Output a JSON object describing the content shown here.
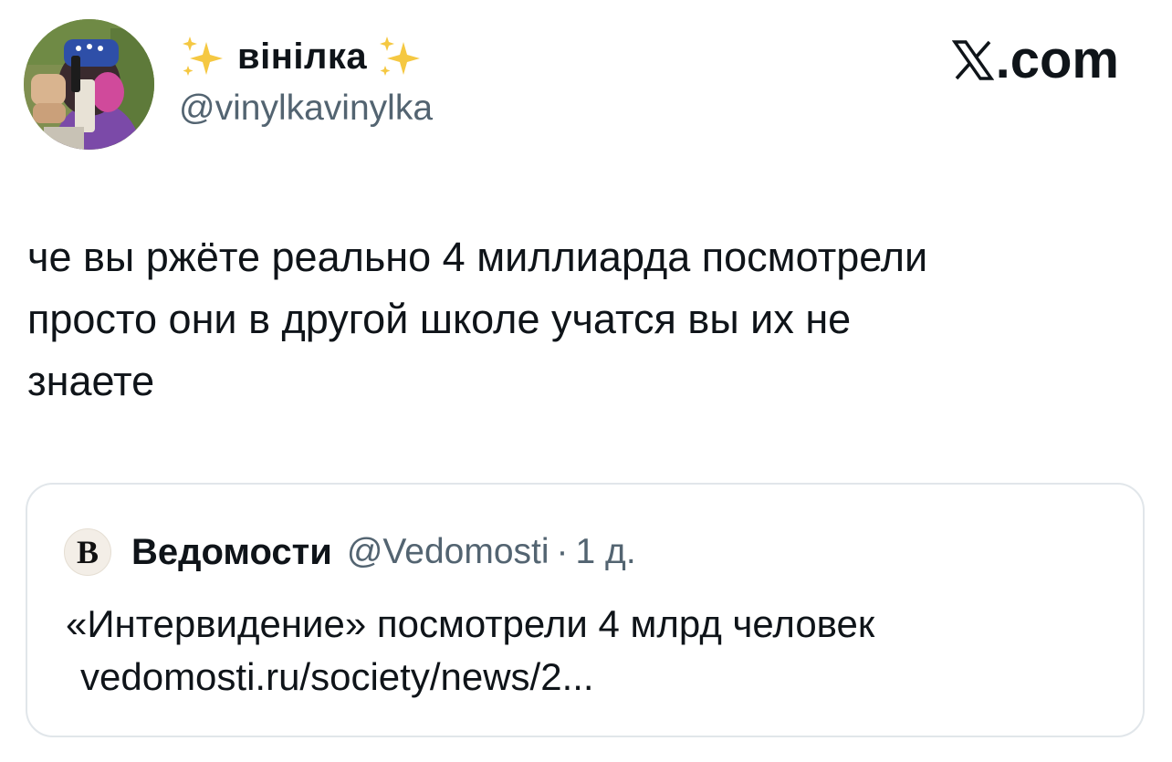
{
  "author": {
    "display_name": "вінілка",
    "handle": "@vinylkavinylka",
    "avatar_icon": "cartoon-avatar",
    "name_decoration_icon": "sparkles-emoji"
  },
  "brand": {
    "logo_icon": "x-logo-icon",
    "label": ".com"
  },
  "tweet": {
    "lines": [
      "че вы ржёте реально 4 миллиарда посмотрели",
      "просто они в другой школе учатся вы их не",
      "знаете"
    ]
  },
  "quote": {
    "avatar_letter": "В",
    "name": "Ведомости",
    "handle": "@Vedomosti",
    "separator": "·",
    "time": "1 д.",
    "text_line": "«Интервидение» посмотрели 4 млрд человек",
    "link_text": "vedomosti.ru/society/news/2..."
  },
  "colors": {
    "text_primary": "#0f1419",
    "text_secondary": "#536471",
    "card_border": "#e1e6ea",
    "sparkle": "#f5c842"
  }
}
